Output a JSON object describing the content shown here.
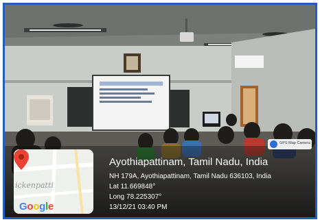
{
  "overlay": {
    "camera_badge": "GPS Map Camera",
    "map": {
      "place_label": "ickenpatti",
      "provider": "Google",
      "pin_icon": "map-pin-icon"
    },
    "location_title": "Ayothiapattinam, Tamil Nadu, India",
    "address": "NH 179A, Ayothiapattinam, Tamil Nadu 636103, India",
    "latitude": "Lat 11.669848°",
    "longitude": "Long 78.225307°",
    "timestamp": "13/12/21 03:40 PM"
  },
  "colors": {
    "frame_border": "#1f5fc4",
    "google_blue": "#4285F4",
    "google_red": "#EA4335",
    "google_yellow": "#FBBC05",
    "google_green": "#34A853"
  }
}
